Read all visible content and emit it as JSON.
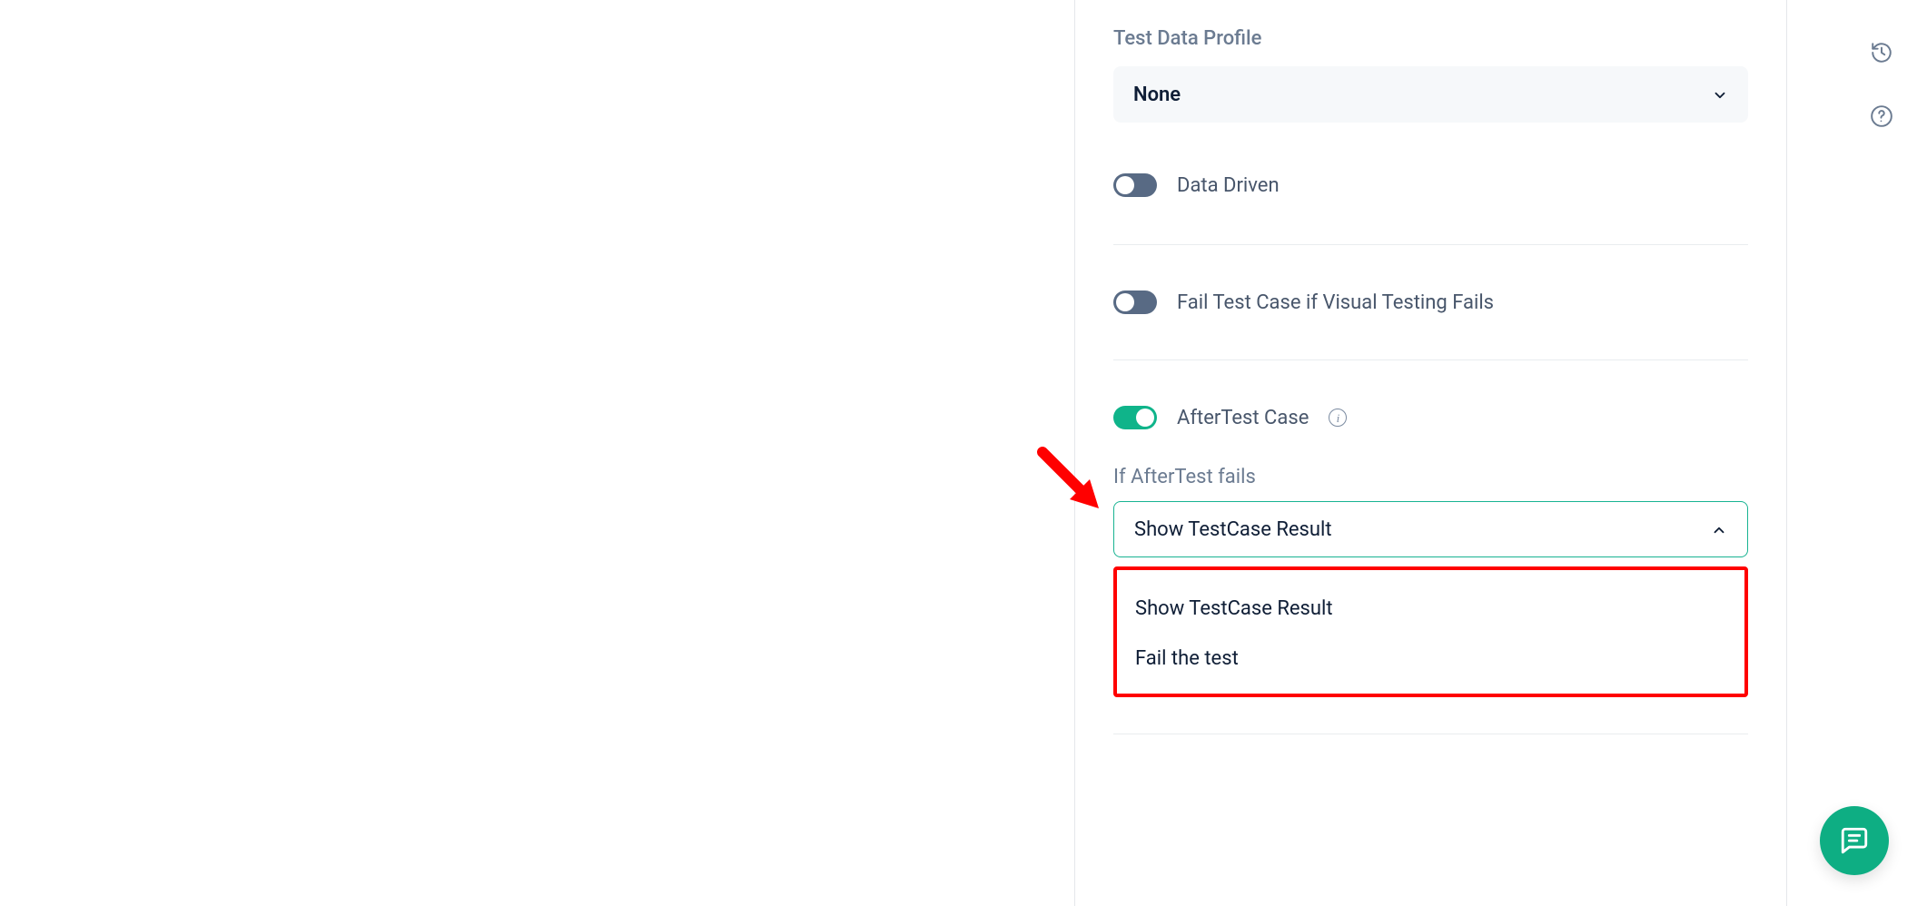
{
  "panel": {
    "testDataProfile": {
      "label": "Test Data Profile",
      "value": "None"
    },
    "toggles": {
      "dataDriven": {
        "label": "Data Driven",
        "on": false
      },
      "failIfVisualFails": {
        "label": "Fail Test Case if Visual Testing Fails",
        "on": false
      },
      "afterTestCase": {
        "label": "AfterTest Case",
        "on": true
      }
    },
    "afterTestFails": {
      "label": "If AfterTest fails",
      "selected": "Show TestCase Result",
      "options": [
        "Show TestCase Result",
        "Fail the test"
      ]
    }
  },
  "rightStrip": {
    "historyTooltip": "History",
    "helpTooltip": "Help"
  },
  "fab": {
    "tooltip": "Chat"
  }
}
